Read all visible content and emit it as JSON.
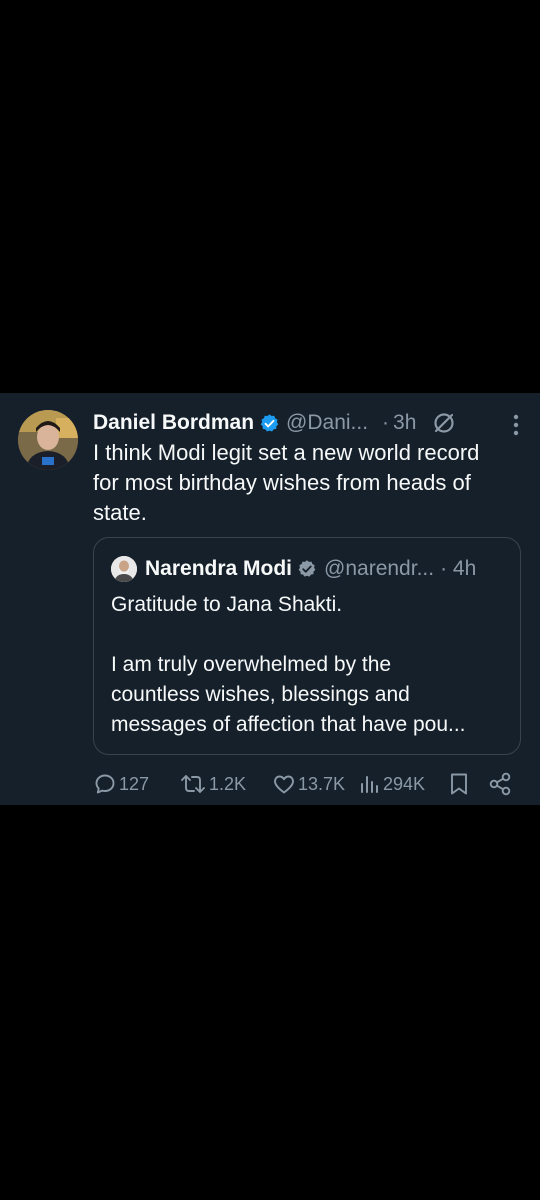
{
  "tweet": {
    "author_name": "Daniel Bordman",
    "handle": "@Dani...",
    "separator": "·",
    "time": "3h",
    "text": "I think Modi legit set a new world record\nfor most birthday wishes from heads of\nstate.",
    "avatar_icon": "person-avatar-photo",
    "verified_icon": "verified-badge-icon",
    "grok_icon": "no-slash-icon",
    "more_icon": "more-vertical-icon"
  },
  "quote": {
    "author_name": "Narendra Modi",
    "handle": "@narendr...",
    "time": "· 4h",
    "text": "Gratitude to Jana Shakti.\n\nI am truly overwhelmed by the\ncountless wishes, blessings and\nmessages of affection that have pou...",
    "avatar_icon": "person-avatar-photo",
    "verified_icon": "verified-badge-icon"
  },
  "actions": {
    "replies": "127",
    "retweets": "1.2K",
    "likes": "13.7K",
    "views": "294K",
    "reply_icon": "reply-icon",
    "retweet_icon": "retweet-icon",
    "like_icon": "heart-icon",
    "views_icon": "analytics-icon",
    "bookmark_icon": "bookmark-icon",
    "share_icon": "share-icon"
  },
  "colors": {
    "background": "#000000",
    "card": "#15202b",
    "text_primary": "#f7f9f9",
    "text_secondary": "#8b98a5",
    "verified_blue": "#1d9bf0",
    "border": "#38444d"
  }
}
